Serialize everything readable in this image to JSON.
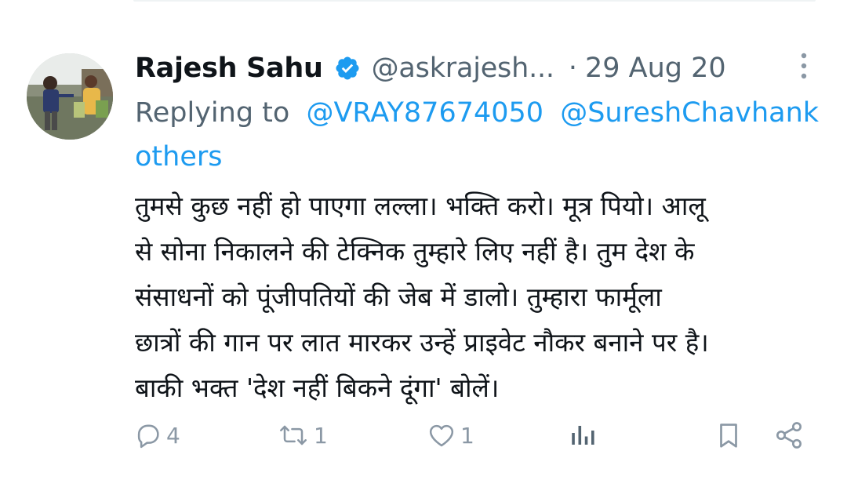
{
  "tweet": {
    "author_name": "Rajesh Sahu",
    "handle": "@askrajesh...",
    "separator": "·",
    "date": "29 Aug 20",
    "replying_to_label": "Replying to",
    "mentions": [
      "@VRAY87674050",
      "@SureshChavhank"
    ],
    "others": "others",
    "text_lines": [
      "तुमसे कुछ नहीं हो पाएगा लल्ला। भक्ति करो। मूत्र पियो। आलू",
      "से सोना निकालने की टेक्निक तुम्हारे लिए नहीं है। तुम देश के",
      "संसाधनों को पूंजीपतियों की जेब में डालो। तुम्हारा फार्मूला",
      "छात्रों की गान पर लात मारकर उन्हें प्राइवेट नौकर बनाने पर है।",
      "बाकी भक्त 'देश नहीं बिकने दूंगा' बोलें।"
    ]
  },
  "actions": {
    "reply_count": "4",
    "retweet_count": "1",
    "like_count": "1"
  },
  "icons": {
    "verified": "verified-badge-icon",
    "more": "more-vertical-icon",
    "reply": "reply-icon",
    "retweet": "retweet-icon",
    "like": "heart-icon",
    "views": "analytics-icon",
    "bookmark": "bookmark-icon",
    "share": "share-icon"
  },
  "colors": {
    "text": "#0f1419",
    "secondary": "#536471",
    "link": "#1d9bf0",
    "icon": "#8b98a5",
    "verified": "#1d9bf0"
  }
}
